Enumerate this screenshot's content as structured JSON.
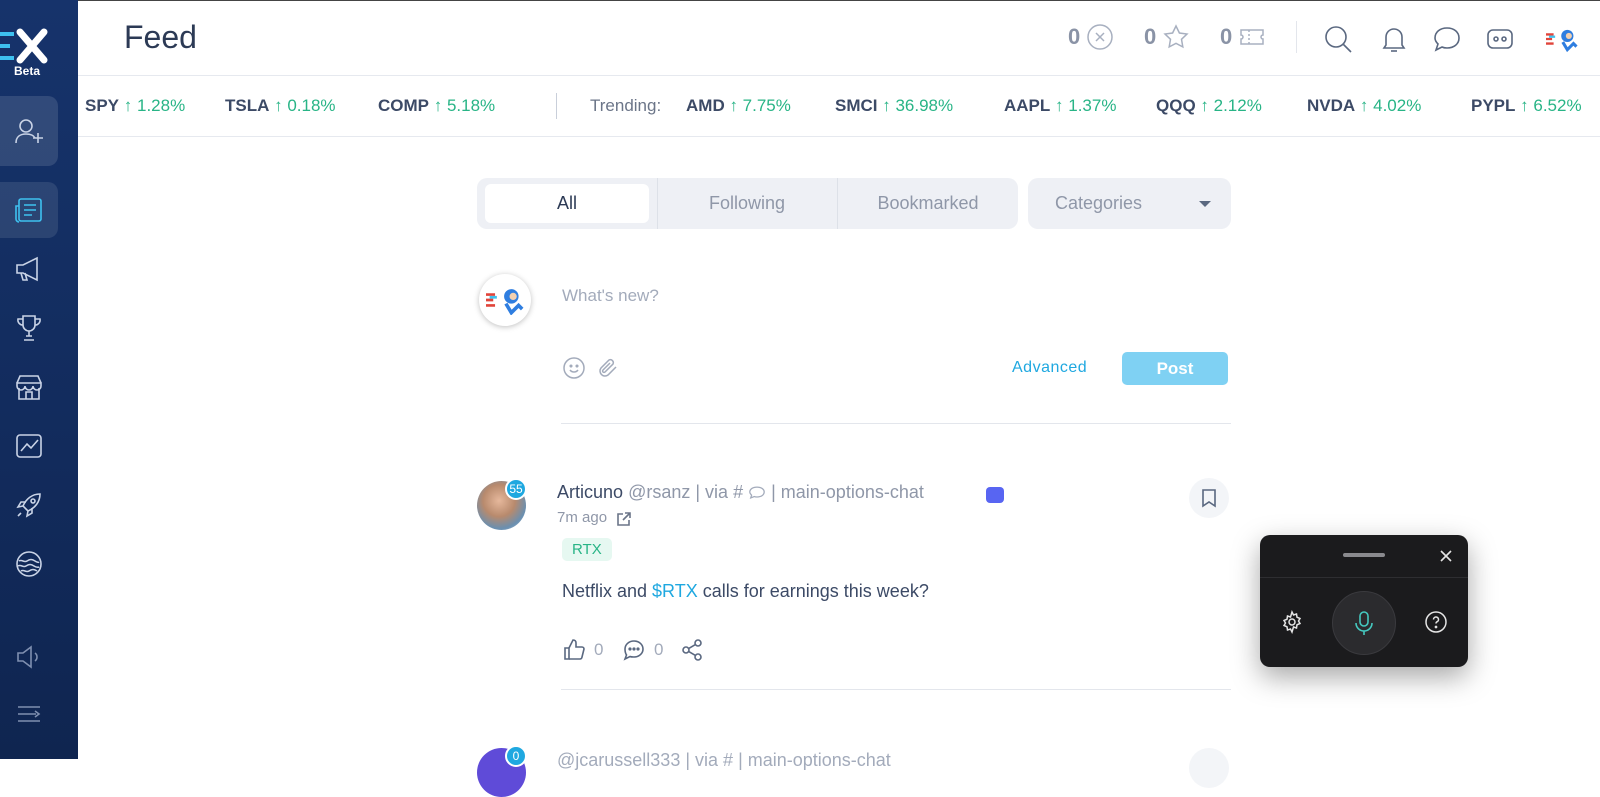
{
  "app": {
    "logo_text": "X",
    "beta_label": "Beta"
  },
  "header": {
    "title": "Feed",
    "counters": [
      {
        "value": "0",
        "icon": "x-coin-icon"
      },
      {
        "value": "0",
        "icon": "star-icon"
      },
      {
        "value": "0",
        "icon": "ticket-icon"
      }
    ]
  },
  "ticker": {
    "items": [
      {
        "symbol": "SPY",
        "change": "↑ 1.28%"
      },
      {
        "symbol": "TSLA",
        "change": "↑ 0.18%"
      },
      {
        "symbol": "COMP",
        "change": "↑ 5.18%"
      }
    ],
    "trending_label": "Trending:",
    "trending": [
      {
        "symbol": "AMD",
        "change": "↑ 7.75%"
      },
      {
        "symbol": "SMCI",
        "change": "↑ 36.98%"
      },
      {
        "symbol": "AAPL",
        "change": "↑ 1.37%"
      },
      {
        "symbol": "QQQ",
        "change": "↑ 2.12%"
      },
      {
        "symbol": "NVDA",
        "change": "↑ 4.02%"
      },
      {
        "symbol": "PYPL",
        "change": "↑ 6.52%"
      }
    ]
  },
  "filters": {
    "tabs": [
      "All",
      "Following",
      "Bookmarked"
    ],
    "active_tab": "All",
    "categories_label": "Categories"
  },
  "composer": {
    "placeholder": "What's new?",
    "advanced_label": "Advanced",
    "post_label": "Post"
  },
  "posts": [
    {
      "author": "Articuno",
      "handle": "@rsanz",
      "via": "| via #",
      "channel": "| main-options-chat",
      "badge": "55",
      "time": "7m ago",
      "tag": "RTX",
      "text_before": "Netflix and ",
      "cashtag": "$RTX",
      "text_after": " calls for earnings this week?",
      "likes": "0",
      "comments": "0"
    },
    {
      "author": "@jcarussell333",
      "via": "| via #",
      "channel": "| main-options-chat",
      "badge": "0"
    }
  ],
  "colors": {
    "sidebar_bg": "#16336b",
    "accent": "#1fa8e0",
    "positive": "#28b486",
    "post_button": "#7fd1f3",
    "discord": "#5865f2"
  }
}
